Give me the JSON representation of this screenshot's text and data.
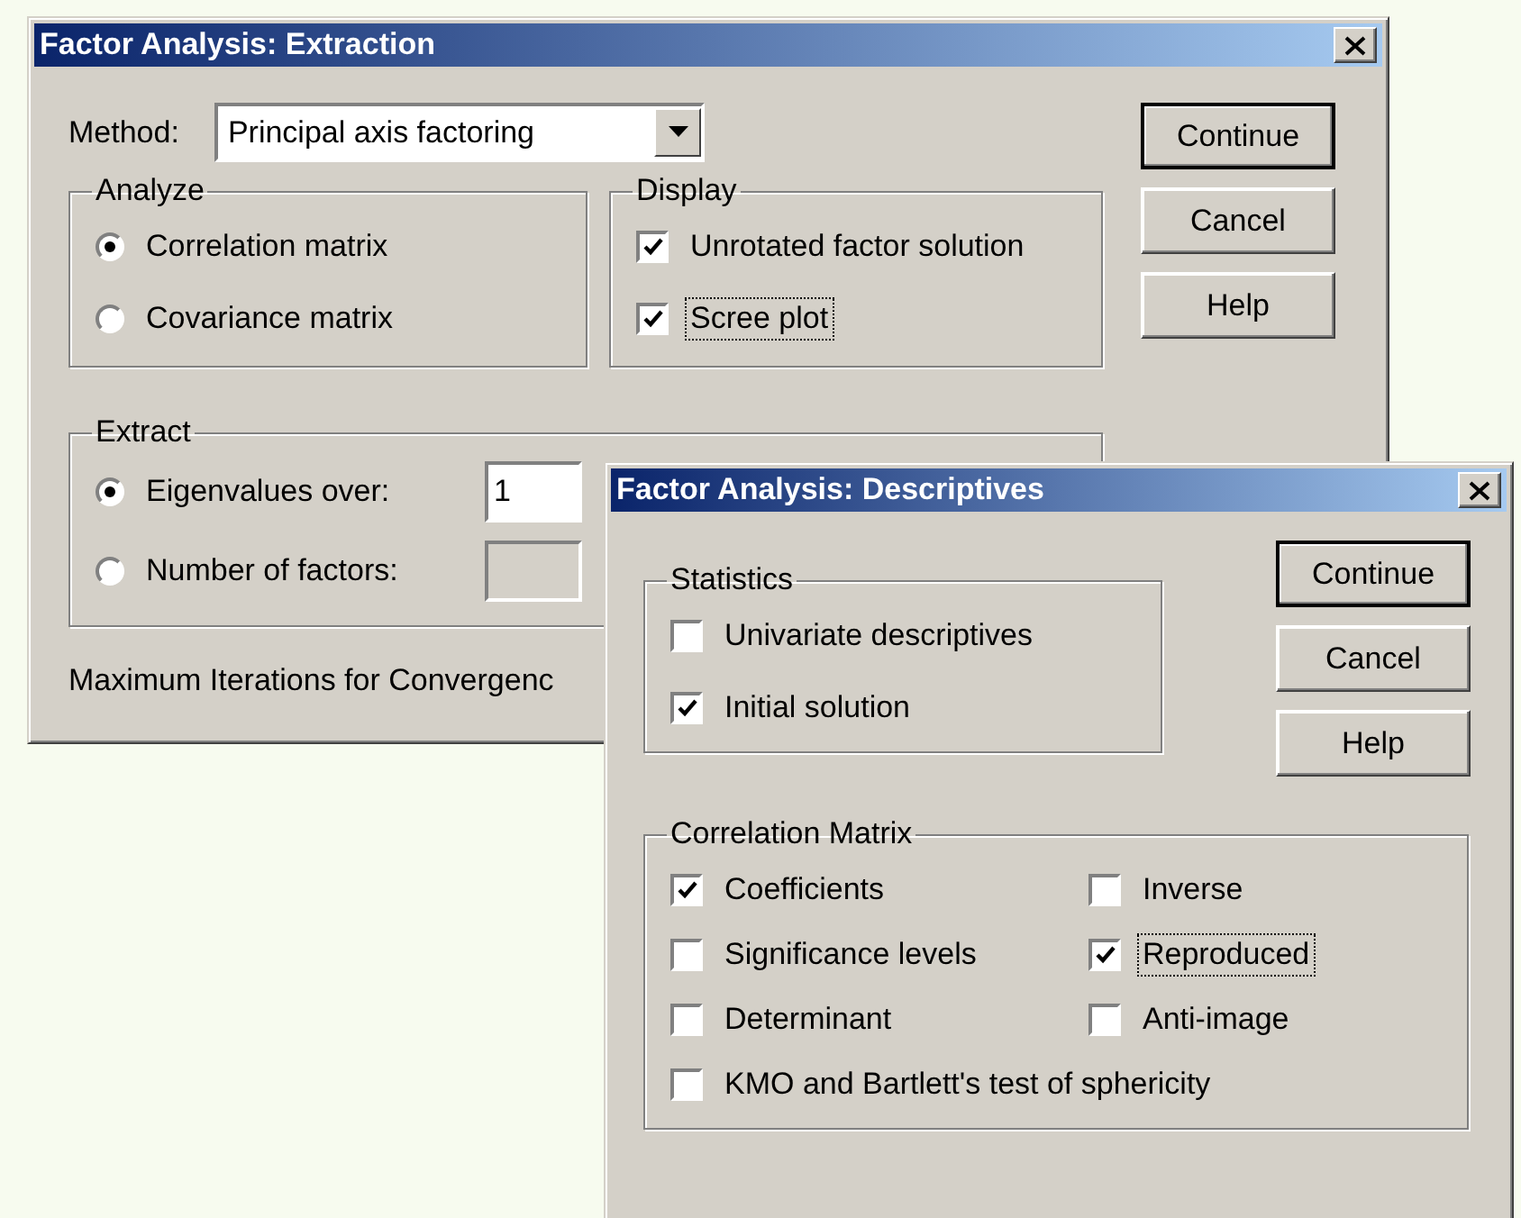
{
  "extraction_dialog": {
    "title": "Factor Analysis: Extraction",
    "method": {
      "label": "Method:",
      "value": "Principal axis factoring"
    },
    "analyze": {
      "title": "Analyze",
      "options": [
        {
          "label": "Correlation matrix",
          "selected": true
        },
        {
          "label": "Covariance matrix",
          "selected": false
        }
      ]
    },
    "display": {
      "title": "Display",
      "options": [
        {
          "label": "Unrotated factor solution",
          "checked": true,
          "focused": false
        },
        {
          "label": "Scree plot",
          "checked": true,
          "focused": true
        }
      ]
    },
    "extract": {
      "title": "Extract",
      "options": [
        {
          "label": "Eigenvalues over:",
          "selected": true,
          "value": "1",
          "disabled": false
        },
        {
          "label": "Number of factors:",
          "selected": false,
          "disabled": true
        }
      ]
    },
    "iterations_label": "Maximum Iterations for Convergenc",
    "buttons": [
      {
        "label": "Continue",
        "default": true
      },
      {
        "label": "Cancel",
        "default": false
      },
      {
        "label": "Help",
        "default": false
      }
    ]
  },
  "descriptives_dialog": {
    "title": "Factor Analysis: Descriptives",
    "statistics": {
      "title": "Statistics",
      "options": [
        {
          "label": "Univariate descriptives",
          "checked": false,
          "focused": false
        },
        {
          "label": "Initial solution",
          "checked": true,
          "focused": false
        }
      ]
    },
    "buttons": [
      {
        "label": "Continue",
        "default": true
      },
      {
        "label": "Cancel",
        "default": false
      },
      {
        "label": "Help",
        "default": false
      }
    ],
    "correlation_matrix": {
      "title": "Correlation Matrix",
      "options": [
        {
          "label": "Coefficients",
          "checked": true,
          "focused": false
        },
        {
          "label": "Inverse",
          "checked": false,
          "focused": false
        },
        {
          "label": "Significance levels",
          "checked": false,
          "focused": false
        },
        {
          "label": "Reproduced",
          "checked": true,
          "focused": true
        },
        {
          "label": "Determinant",
          "checked": false,
          "focused": false
        },
        {
          "label": "Anti-image",
          "checked": false,
          "focused": false
        },
        {
          "label": "KMO and Bartlett's test of sphericity",
          "checked": false,
          "focused": false
        }
      ]
    }
  }
}
